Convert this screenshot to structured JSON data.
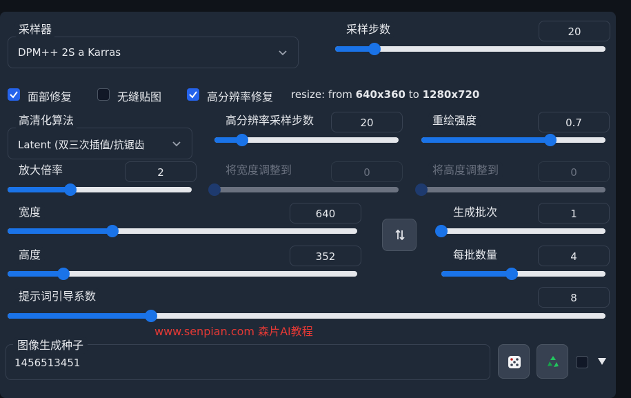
{
  "sampler": {
    "label": "采样器",
    "value": "DPM++ 2S a Karras"
  },
  "steps": {
    "label": "采样步数",
    "value": "20",
    "fraction": 0.145
  },
  "checkboxes": {
    "face_restore": {
      "label": "面部修复",
      "checked": true
    },
    "tiling": {
      "label": "无缝贴图",
      "checked": false
    },
    "hires_fix": {
      "label": "高分辨率修复",
      "checked": true
    }
  },
  "resize": {
    "prefix": "resize: from ",
    "from": "640x360",
    "mid": " to ",
    "to": "1280x720"
  },
  "upscaler": {
    "label": "高清化算法",
    "value": "Latent (双三次插值/抗锯齿"
  },
  "hires_steps": {
    "label": "高分辨率采样步数",
    "value": "20",
    "fraction": 0.15
  },
  "denoise": {
    "label": "重绘强度",
    "value": "0.7",
    "fraction": 0.7
  },
  "upscale_by": {
    "label": "放大倍率",
    "value": "2",
    "fraction": 0.34
  },
  "resize_width": {
    "label": "将宽度调整到",
    "value": "0",
    "fraction": 0
  },
  "resize_height": {
    "label": "将高度调整到",
    "value": "0",
    "fraction": 0
  },
  "width": {
    "label": "宽度",
    "value": "640",
    "fraction": 0.3
  },
  "height": {
    "label": "高度",
    "value": "352",
    "fraction": 0.16
  },
  "batch_count": {
    "label": "生成批次",
    "value": "1",
    "fraction": 0
  },
  "batch_size": {
    "label": "每批数量",
    "value": "4",
    "fraction": 0.43
  },
  "cfg": {
    "label": "提示词引导系数",
    "value": "8",
    "fraction": 0.24
  },
  "seed": {
    "label": "图像生成种子",
    "value": "1456513451"
  },
  "watermark": "www.senpian.com  森片AI教程",
  "colors": {
    "accent": "#1a73e8",
    "panel": "#1f2937",
    "background": "#0f1319",
    "watermark": "#e53935"
  },
  "icons": {
    "swap": "swap-arrows-icon",
    "dice": "dice-icon",
    "recycle": "recycle-icon",
    "dropdown": "triangle-down-icon"
  }
}
